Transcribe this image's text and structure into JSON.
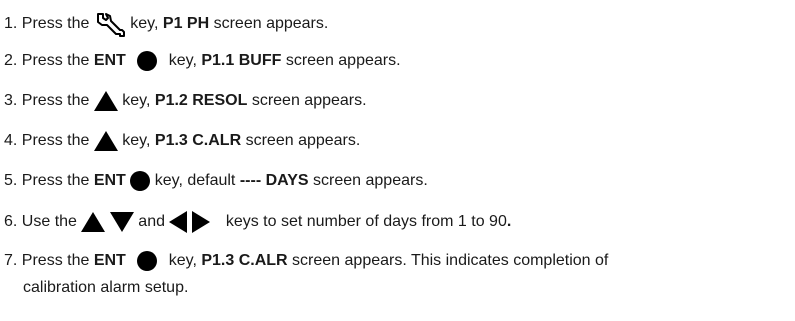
{
  "steps": [
    {
      "num": "1. Press the",
      "mid": "key,",
      "bold": "P1 PH",
      "tail": "screen appears."
    },
    {
      "num": "2. Press the",
      "key": "ENT",
      "mid": "key,",
      "bold": "P1.1 BUFF",
      "tail": "screen appears."
    },
    {
      "num": "3. Press the",
      "mid": "key,",
      "bold": "P1.2 RESOL",
      "tail": "screen appears."
    },
    {
      "num": "4. Press the",
      "mid": "key,",
      "bold": "P1.3 C.ALR",
      "tail": "screen appears."
    },
    {
      "num": "5. Press the",
      "key": "ENT",
      "mid": "key, default",
      "bold": "---- DAYS",
      "tail": "screen appears."
    },
    {
      "num": "6. Use the",
      "and": "and",
      "tail": "keys to set number of days from 1 to 90",
      "period": "."
    },
    {
      "num": "7. Press the",
      "key": "ENT",
      "mid": "key,",
      "bold": "P1.3 C.ALR",
      "tail": "screen appears. This indicates completion of",
      "tail2": "calibration alarm setup."
    }
  ]
}
